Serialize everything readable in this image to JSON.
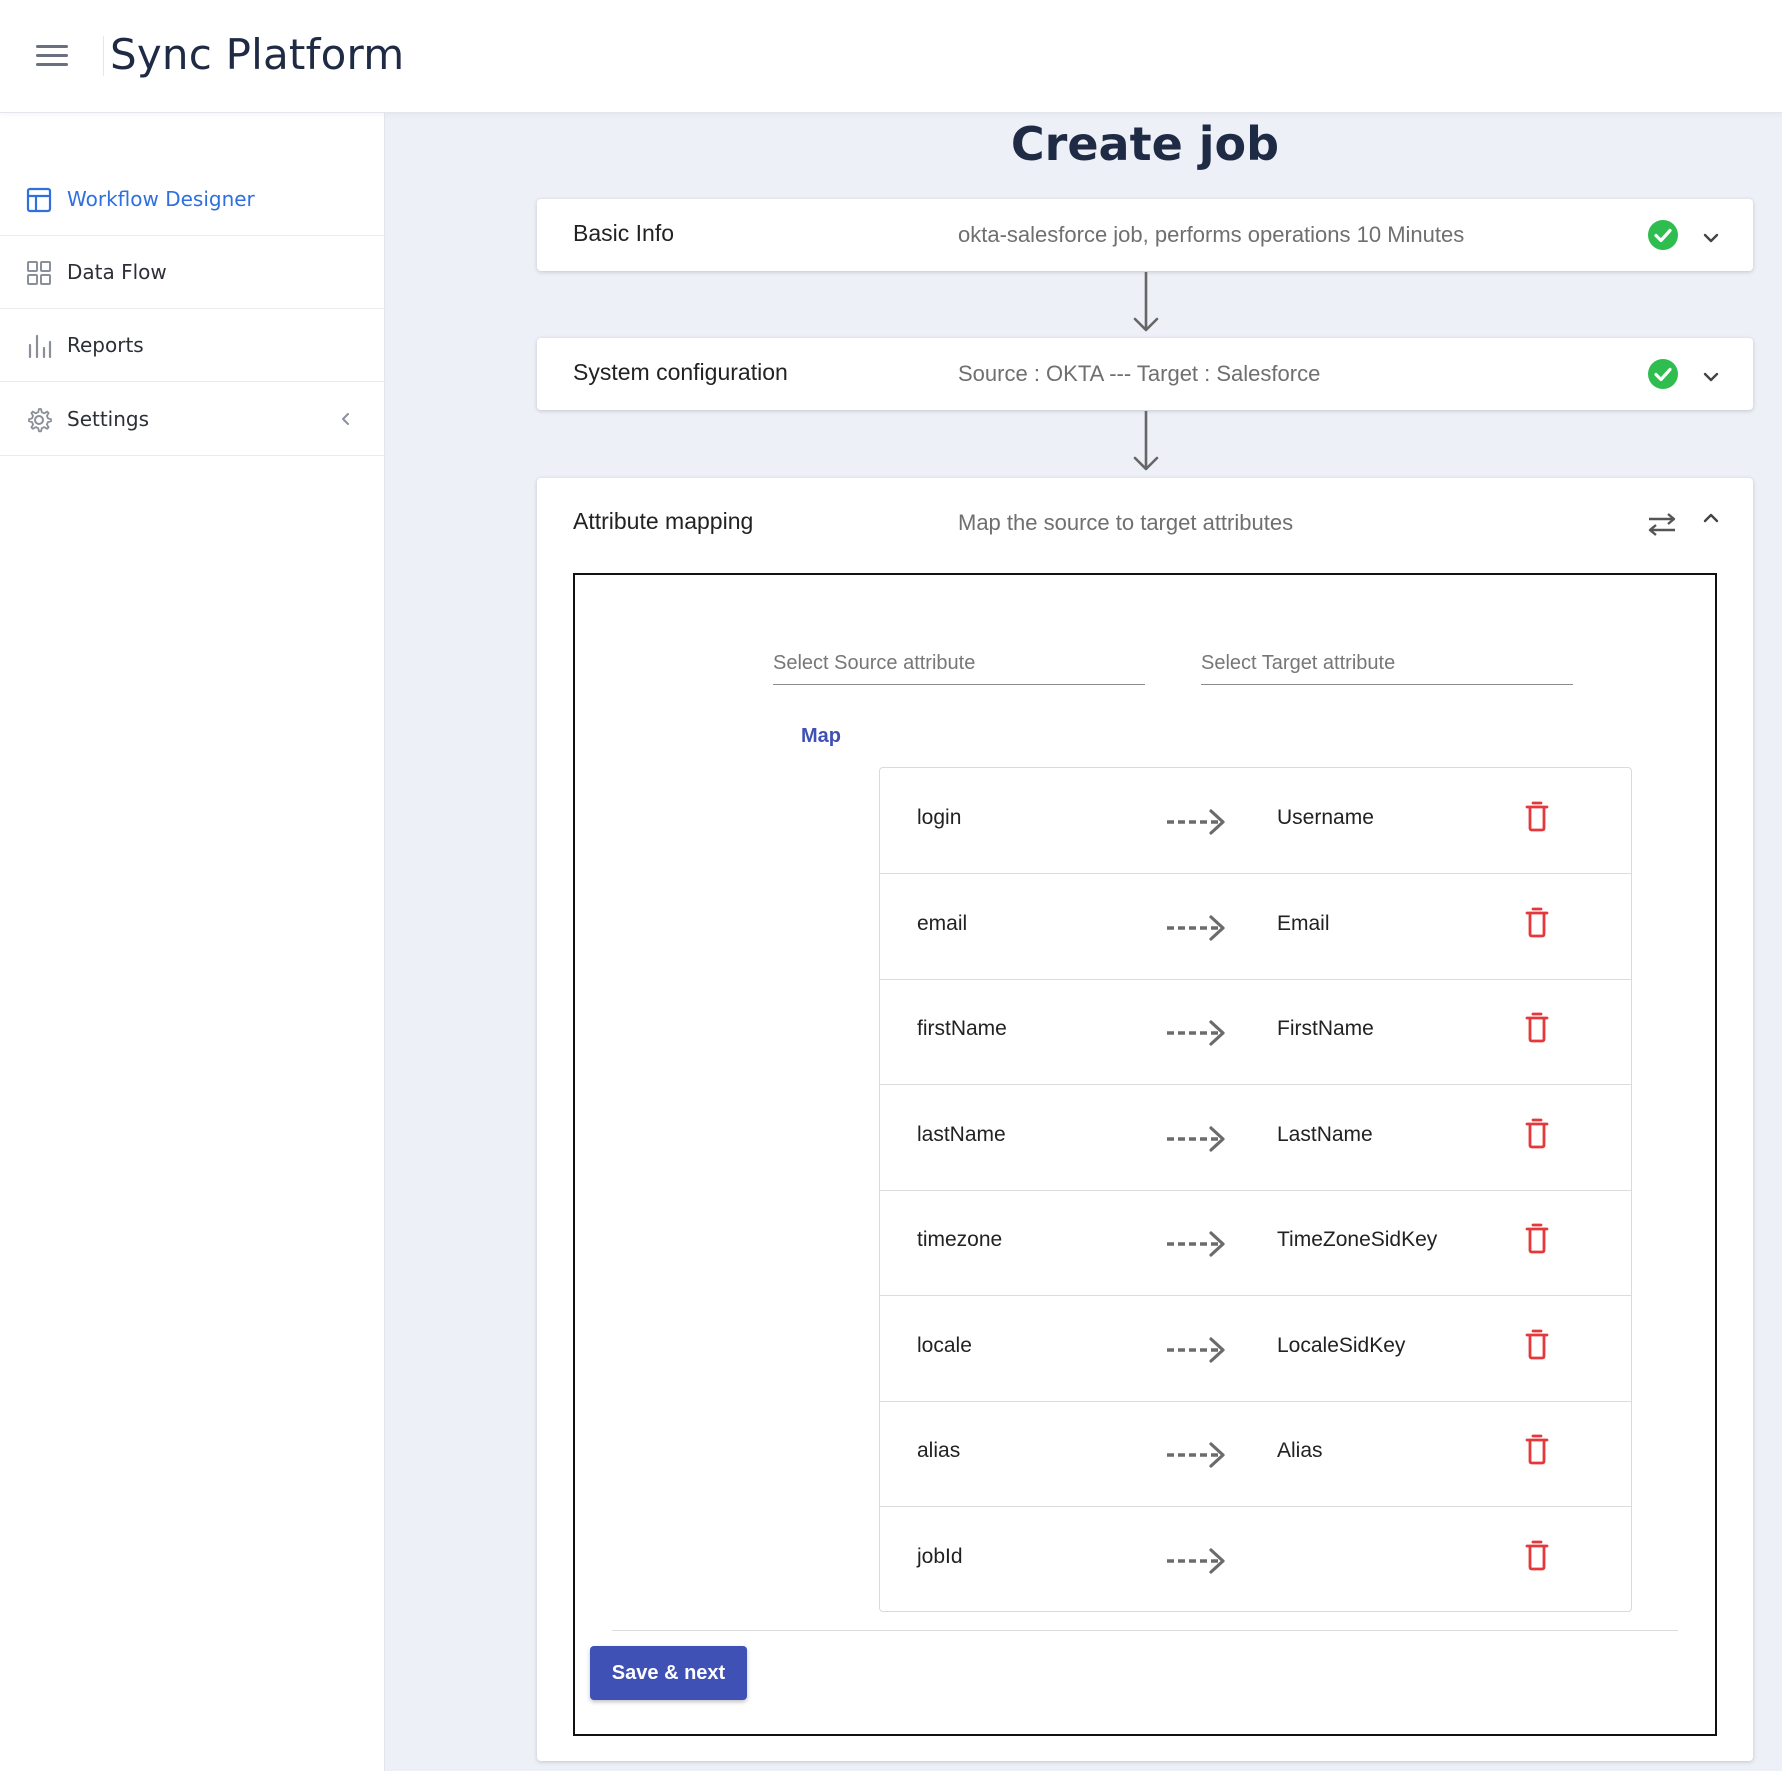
{
  "app": {
    "title": "Sync Platform"
  },
  "sidebar": {
    "items": [
      {
        "label": "Workflow Designer",
        "icon": "layout-icon",
        "active": true
      },
      {
        "label": "Data Flow",
        "icon": "grid-icon",
        "active": false
      },
      {
        "label": "Reports",
        "icon": "bar-chart-icon",
        "active": false
      },
      {
        "label": "Settings",
        "icon": "gear-icon",
        "active": false
      }
    ]
  },
  "page": {
    "heading": "Create job"
  },
  "steps": {
    "basic_info": {
      "title": "Basic Info",
      "summary": "okta-salesforce job, performs operations 10 Minutes",
      "status": "complete"
    },
    "system_config": {
      "title": "System configuration",
      "summary": "Source : OKTA --- Target : Salesforce",
      "status": "complete"
    },
    "attribute_mapping": {
      "title": "Attribute mapping",
      "summary": "Map the source to target attributes",
      "status": "in-progress"
    }
  },
  "mapping": {
    "source_placeholder": "Select Source attribute",
    "target_placeholder": "Select Target attribute",
    "map_label": "Map",
    "rows": [
      {
        "source": "login",
        "target": "Username"
      },
      {
        "source": "email",
        "target": "Email"
      },
      {
        "source": "firstName",
        "target": "FirstName"
      },
      {
        "source": "lastName",
        "target": "LastName"
      },
      {
        "source": "timezone",
        "target": "TimeZoneSidKey"
      },
      {
        "source": "locale",
        "target": "LocaleSidKey"
      },
      {
        "source": "alias",
        "target": "Alias"
      },
      {
        "source": "jobId",
        "target": ""
      }
    ],
    "save_label": "Save & next"
  },
  "colors": {
    "accent": "#2f6fdf",
    "primary_button": "#3f51b5",
    "success": "#2ebd4e",
    "danger": "#e5383b",
    "background": "#edf0f7"
  }
}
